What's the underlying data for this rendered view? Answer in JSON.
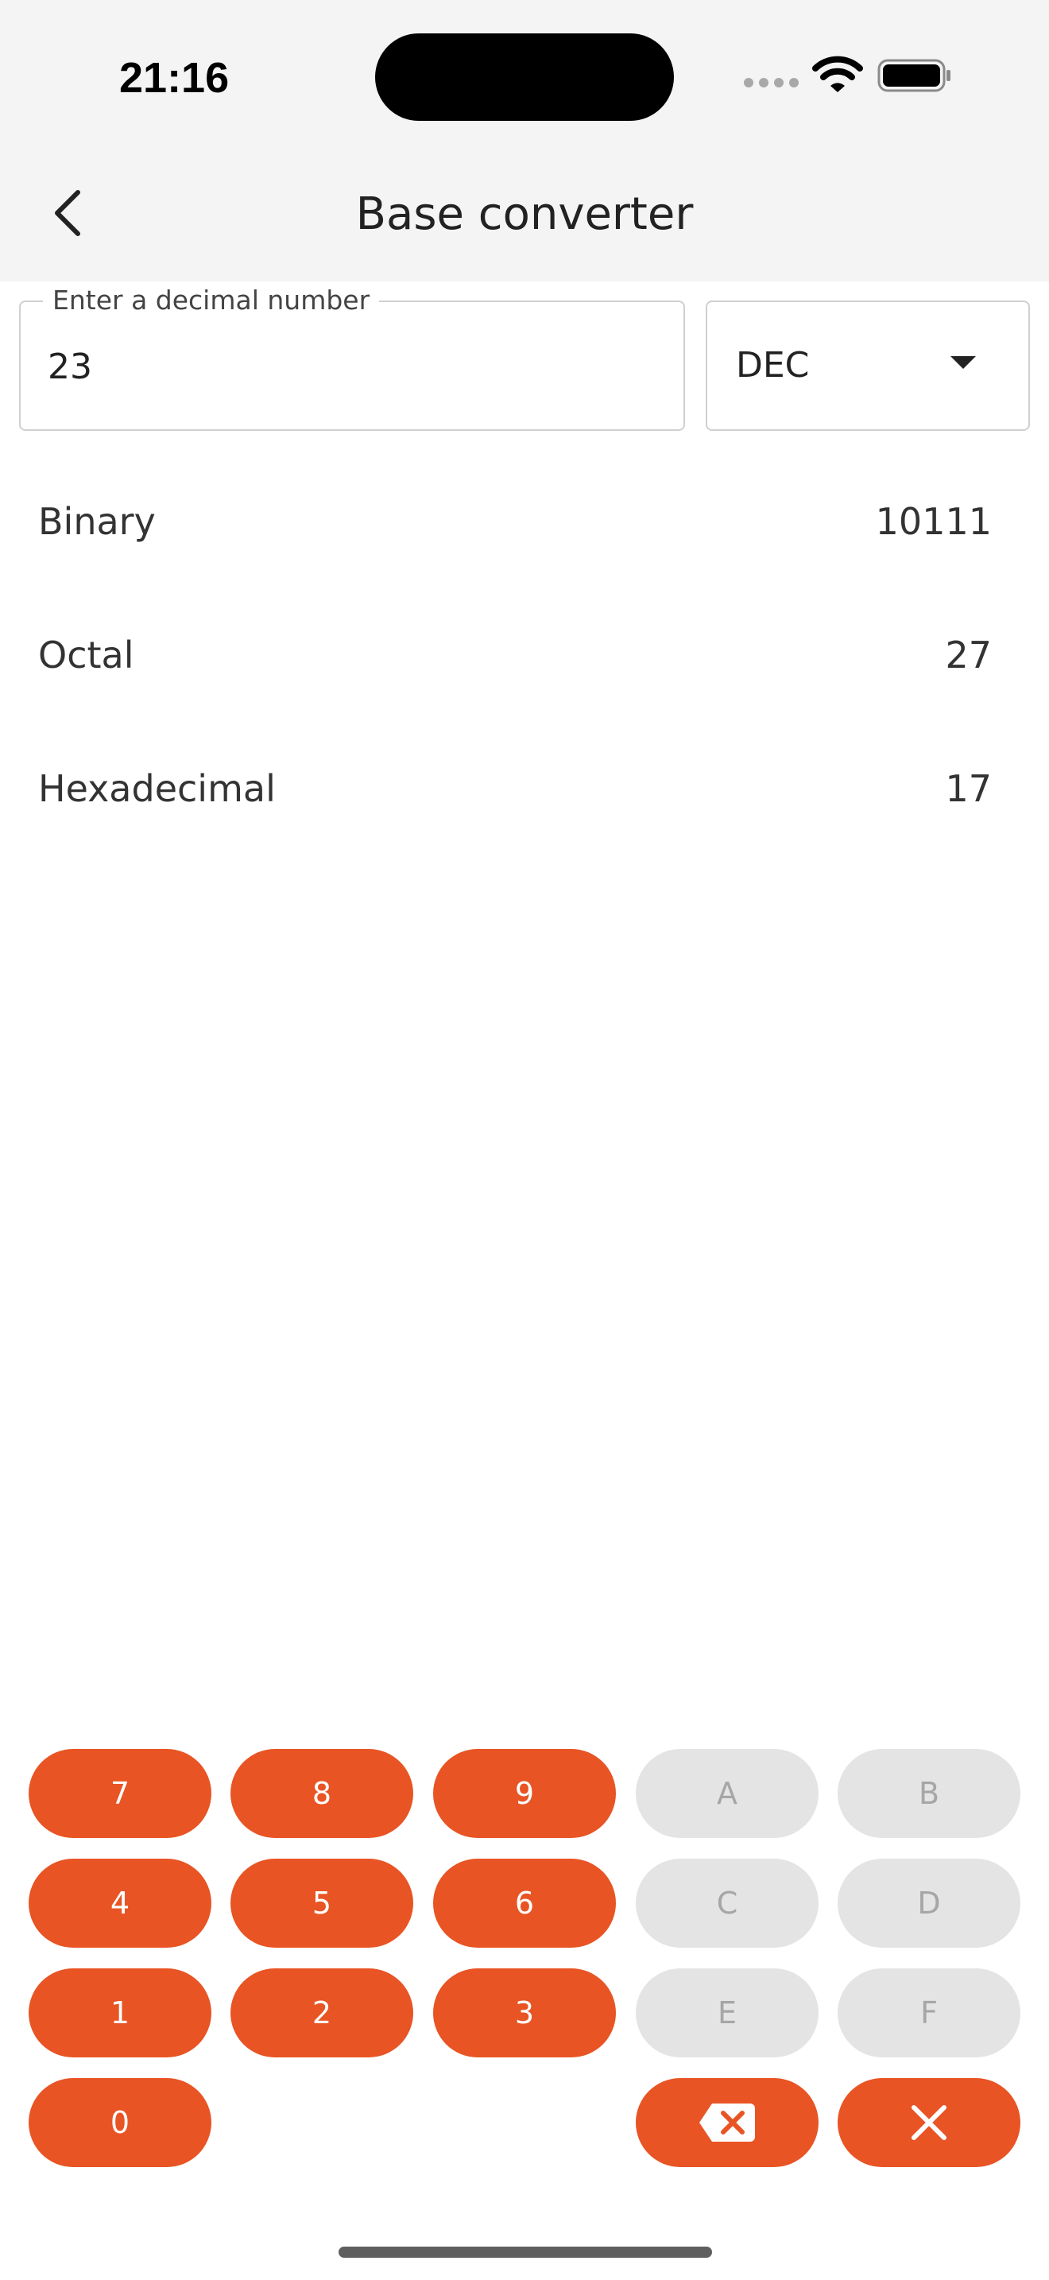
{
  "status_bar": {
    "time": "21:16"
  },
  "header": {
    "title": "Base converter",
    "back_icon": "chevron-left-icon"
  },
  "input": {
    "label": "Enter a decimal number",
    "value": "23"
  },
  "base_select": {
    "value": "DEC"
  },
  "results": [
    {
      "name": "Binary",
      "value": "10111"
    },
    {
      "name": "Octal",
      "value": "27"
    },
    {
      "name": "Hexadecimal",
      "value": "17"
    }
  ],
  "keypad": {
    "k7": "7",
    "k8": "8",
    "k9": "9",
    "kA": "A",
    "kB": "B",
    "k4": "4",
    "k5": "5",
    "k6": "6",
    "kC": "C",
    "kD": "D",
    "k1": "1",
    "k2": "2",
    "k3": "3",
    "kE": "E",
    "kF": "F",
    "k0": "0",
    "backspace_icon": "backspace-icon",
    "clear_icon": "close-icon"
  },
  "colors": {
    "accent": "#e85424",
    "disabled_key": "#e4e4e4",
    "disabled_text": "#a6a6a6",
    "header_bg": "#f4f4f4"
  }
}
